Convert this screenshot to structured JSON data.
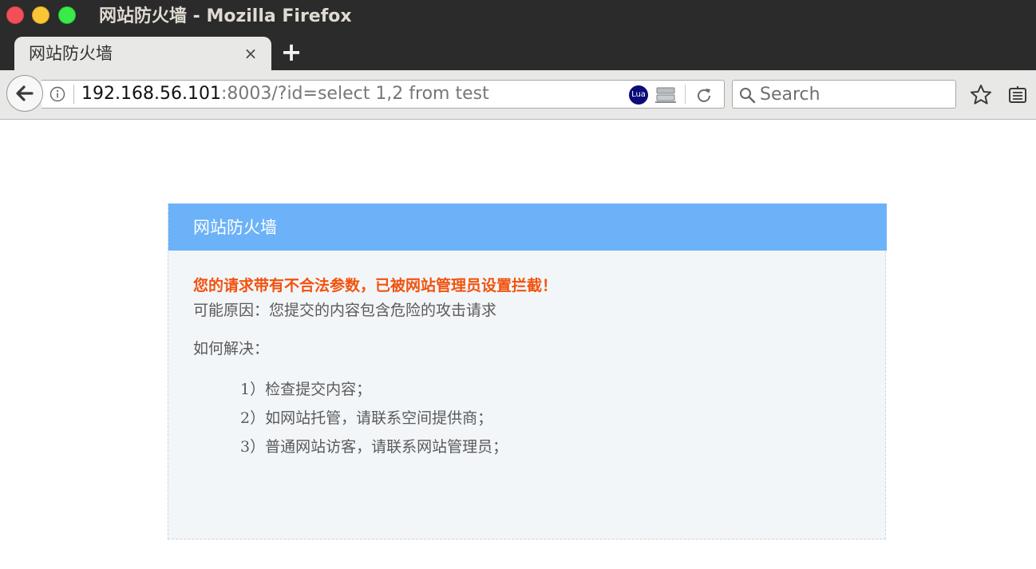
{
  "window": {
    "title": "网站防火墙 - Mozilla Firefox"
  },
  "tabs": [
    {
      "label": "网站防火墙",
      "close": "×"
    }
  ],
  "toolbar": {
    "new_tab": "+",
    "url_host": "192.168.56.101",
    "url_rest": ":8003/?id=select 1,2 from test",
    "lua_badge": "Lua",
    "search_placeholder": "Search"
  },
  "icons": {
    "back": "back-arrow-icon",
    "info": "info-icon",
    "lua": "lua-icon",
    "server": "server-icon",
    "reload": "reload-icon",
    "search": "search-icon",
    "bookmark": "star-icon",
    "reader": "reader-mode-icon"
  },
  "page": {
    "header": "网站防火墙",
    "warning": "您的请求带有不合法参数，已被网站管理员设置拦截！",
    "reason": "可能原因：您提交的内容包含危险的攻击请求",
    "howto": "如何解决：",
    "steps": [
      "1）检查提交内容；",
      "2）如网站托管，请联系空间提供商；",
      "3）普通网站访客，请联系网站管理员；"
    ]
  },
  "colors": {
    "header_bg": "#6cb2f8",
    "warning": "#f2520e",
    "panel_bg": "#f3f6f9"
  }
}
